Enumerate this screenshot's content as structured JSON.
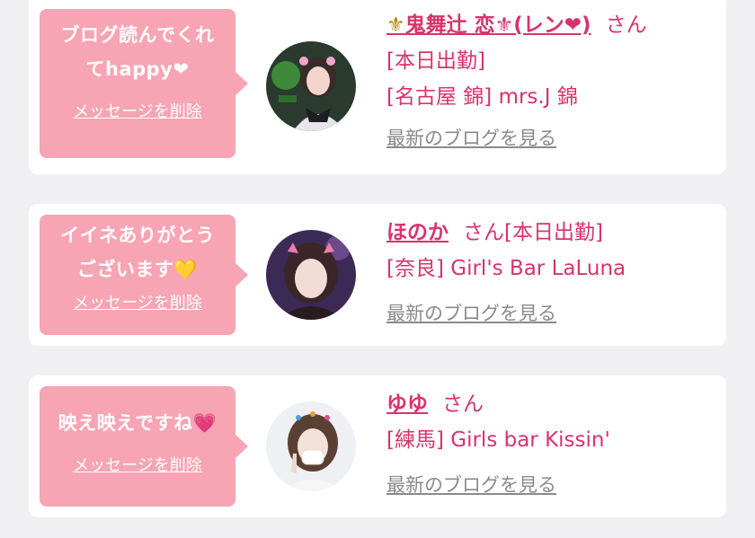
{
  "colors": {
    "accent": "#d8336b",
    "bubble": "#f7a4b4",
    "muted": "#8a8a8a",
    "background": "#f0f0f2"
  },
  "cards": [
    {
      "message_line1": "ブログ読んでくれ",
      "message_line2": "てhappy❤",
      "delete_label": "メッセージを削除",
      "name_prefix": "⚜",
      "name_core": "鬼舞辻 恋",
      "name_suffix": "⚜(レン❤)",
      "honorific": "さん",
      "status": "[本日出勤]",
      "shop": "[名古屋 錦] mrs.J 錦",
      "blog_link": "最新のブログを見る"
    },
    {
      "message_line1": "イイネありがとう",
      "message_line2": "ございます💛",
      "delete_label": "メッセージを削除",
      "name": "ほのか",
      "honorific": "さん",
      "status": "[本日出勤]",
      "shop": "[奈良] Girl's Bar LaLuna",
      "blog_link": "最新のブログを見る"
    },
    {
      "message_line1": "映え映えですね💗",
      "delete_label": "メッセージを削除",
      "name": "ゆゆ",
      "honorific": "さん",
      "shop": "[練馬] Girls bar Kissin'",
      "blog_link": "最新のブログを見る"
    }
  ]
}
